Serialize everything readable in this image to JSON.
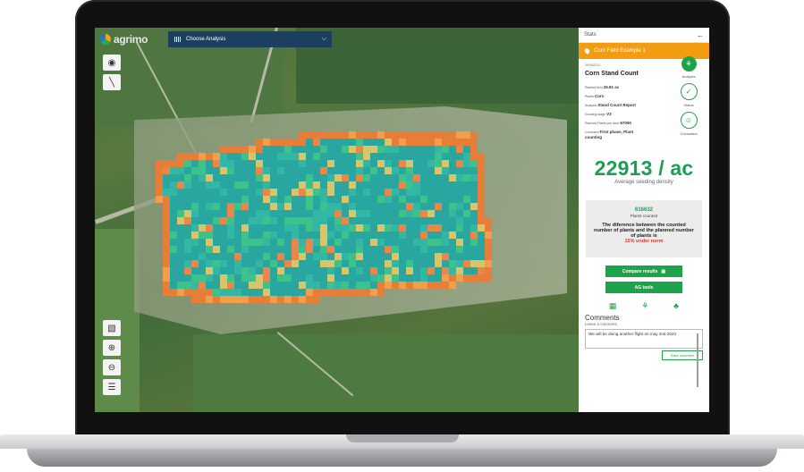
{
  "app": {
    "logo_text": "agrimo"
  },
  "analysis_dropdown": {
    "label": "Choose Analysis",
    "icon": "grid-icon",
    "chevron": "chevron-down-icon"
  },
  "map_tools": {
    "top": [
      "location-pin-icon",
      "measure-line-icon"
    ],
    "bottom": [
      "layer-filter-icon",
      "zoom-in-icon",
      "zoom-out-icon",
      "layers-icon"
    ]
  },
  "panel": {
    "header": "Stats",
    "back_icon": "arrow-left-icon",
    "field_name": "Corn Field Example 1",
    "date": "05/05/2021",
    "title": "Corn Stand Count",
    "rows": [
      {
        "key": "Planted field",
        "value": "26.91 ac"
      },
      {
        "key": "Plants",
        "value": "Corn"
      },
      {
        "key": "Analysis",
        "value": "Stand Count Report"
      },
      {
        "key": "Growing stage",
        "value": "V3"
      },
      {
        "key": "Planned Plants per acre",
        "value": "67000"
      },
      {
        "key": "Comment",
        "value": "First phase, Plant counting"
      }
    ],
    "side_icons": [
      {
        "label": "Analysis",
        "icon": "plants-icon"
      },
      {
        "label": "Status",
        "icon": "check-icon"
      },
      {
        "label": "Consultant",
        "icon": "consultant-icon"
      }
    ],
    "big_number": "22913 / ac",
    "big_number_label": "Average seeding density",
    "plants_counted_value": "616632",
    "plants_counted_label": "Plants counted",
    "difference_text": "The diference between the counted number of plants and the planned number of plants is",
    "under_norm": "15% under norm",
    "compare_button": "Compare results",
    "ag_tools_button": "AG tools",
    "comments_title": "Comments",
    "comments_sub": "Leave a comment",
    "comment_text": "We will be doing another flight on may 2nd 2023",
    "save_button": "Save comment"
  },
  "colors": {
    "accent_green": "#1fa34a",
    "orange": "#f39c12",
    "dropdown_blue": "#1c3f5f",
    "red": "#d63a2c"
  }
}
